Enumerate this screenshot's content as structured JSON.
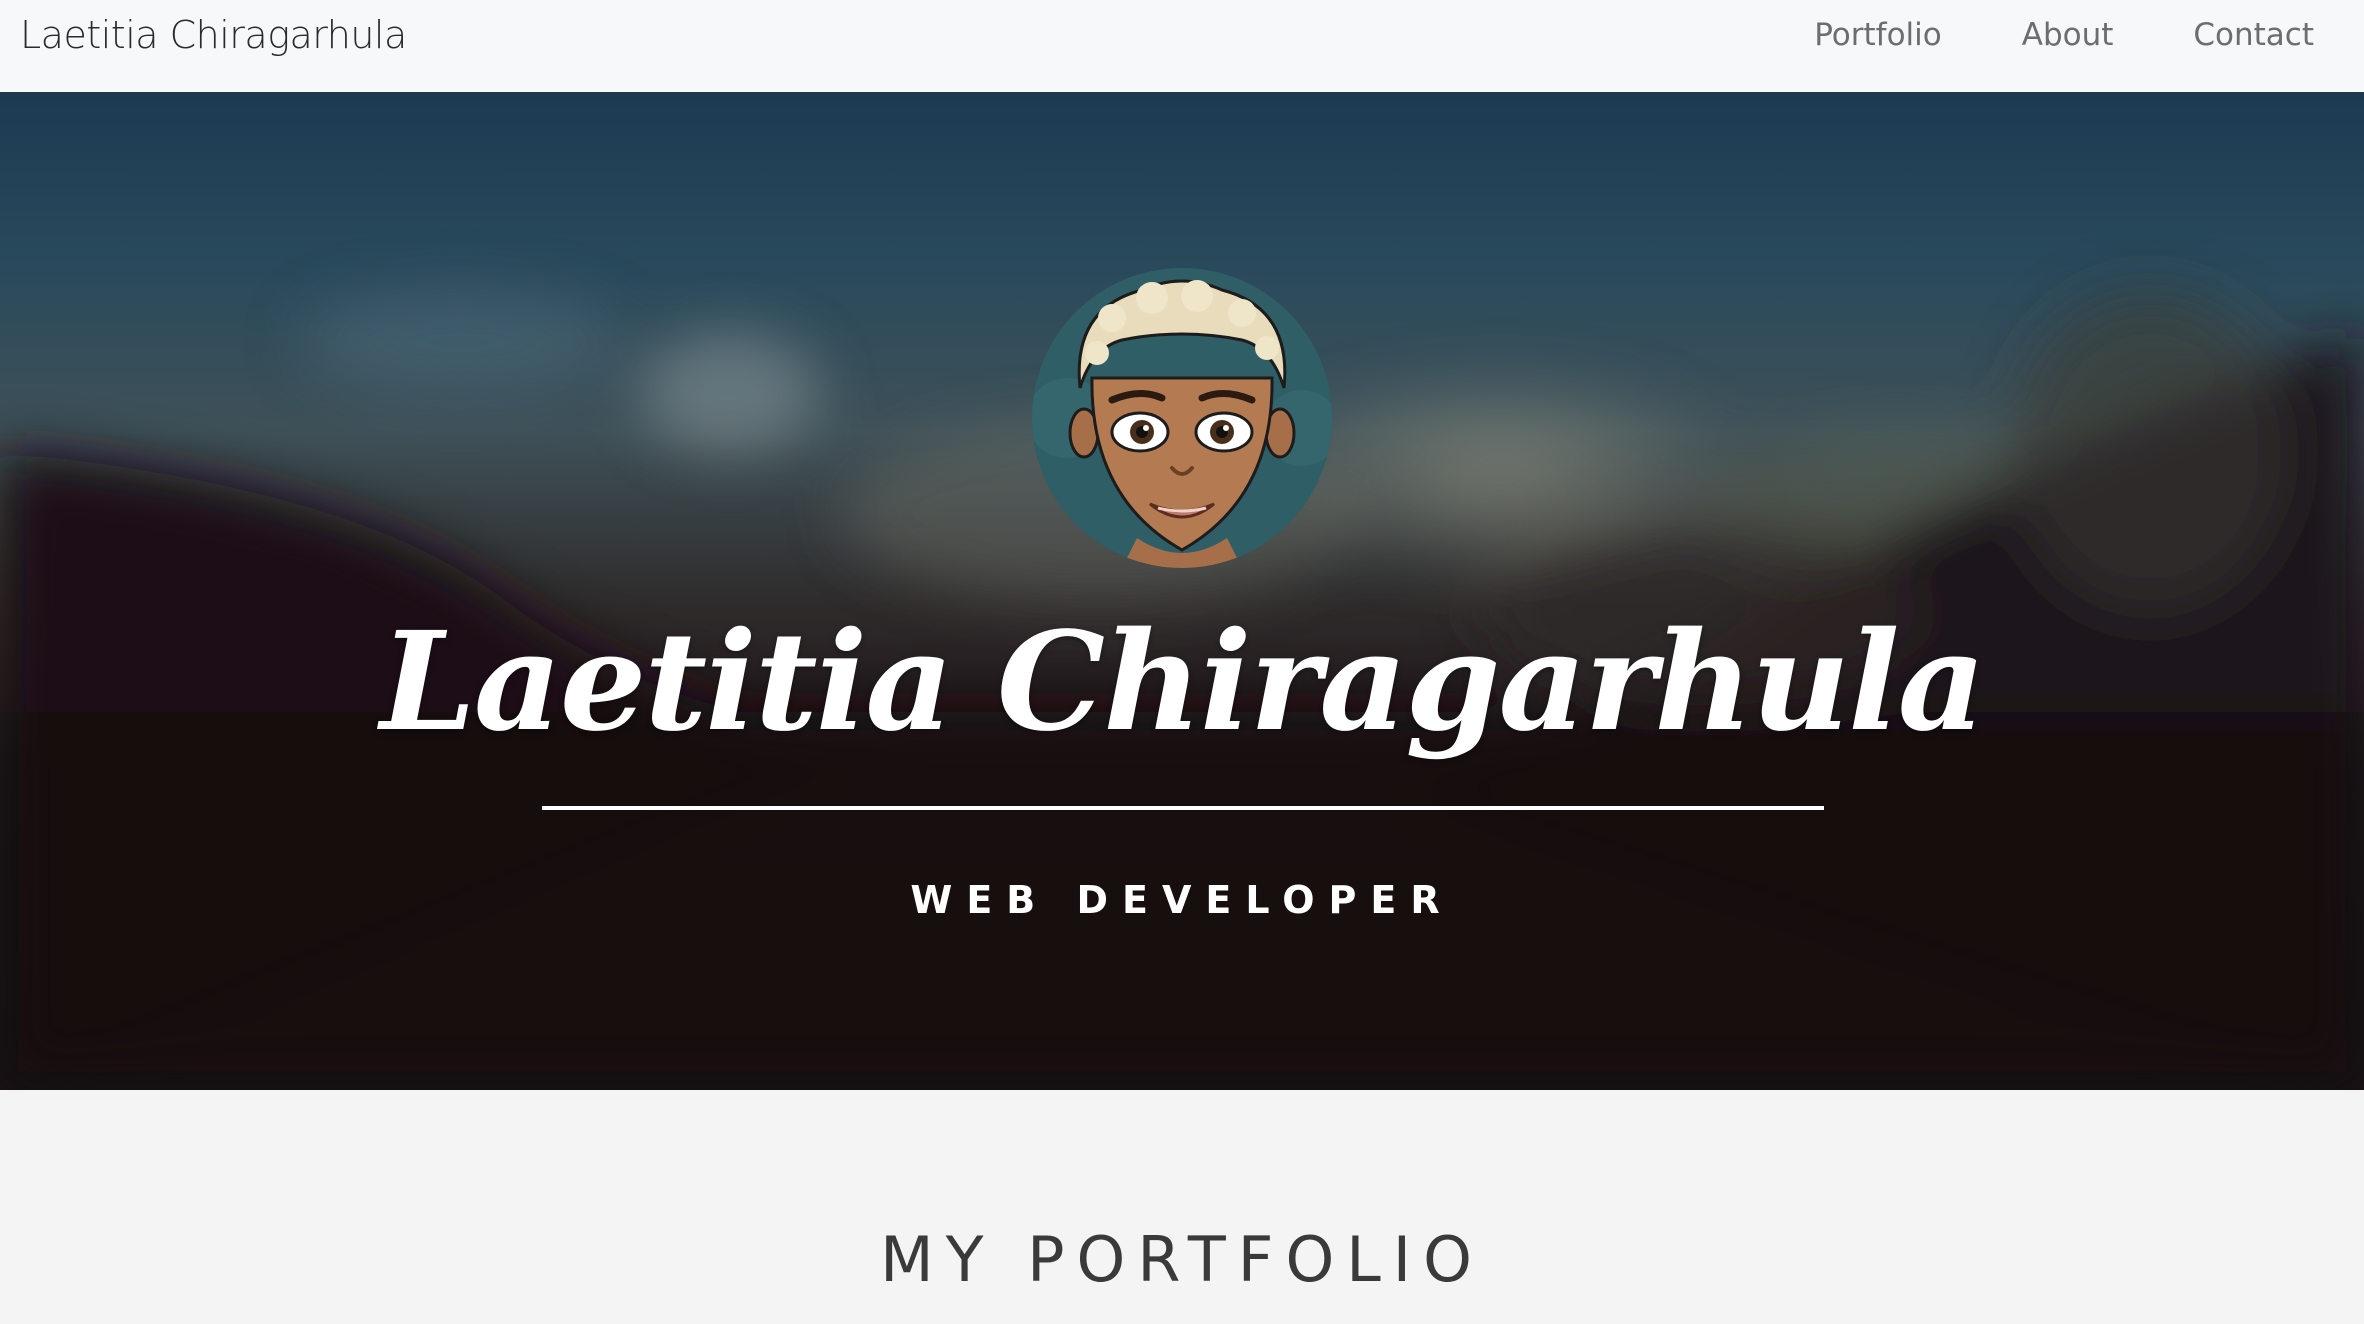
{
  "navbar": {
    "brand": "Laetitia Chiragarhula",
    "links": [
      {
        "label": "Portfolio"
      },
      {
        "label": "About"
      },
      {
        "label": "Contact"
      }
    ]
  },
  "hero": {
    "name": "Laetitia Chiragarhula",
    "subtitle": "WEB DEVELOPER",
    "avatar_icon": "avatar-illustration"
  },
  "portfolio": {
    "title": "MY PORTFOLIO"
  },
  "colors": {
    "navbar_bg": "#f7f8fa",
    "hero_text": "#ffffff",
    "section_bg": "#f4f4f4",
    "section_title": "#3a3a3a"
  }
}
